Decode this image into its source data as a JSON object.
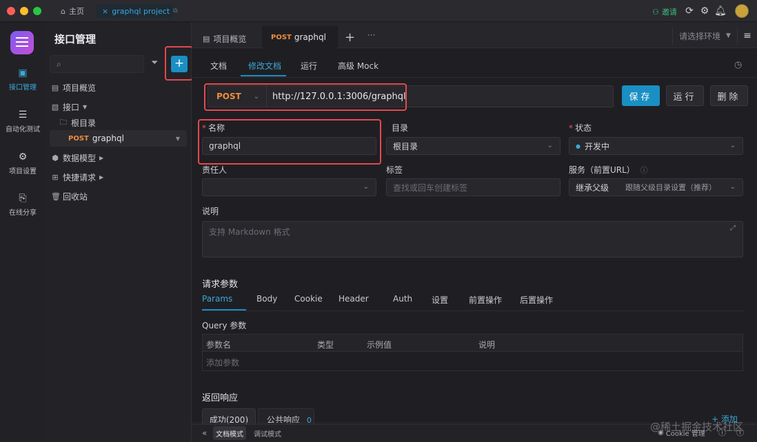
{
  "topbar": {
    "home_label": "主页",
    "project_tab_label": "graphql project",
    "invite_label": "邀请"
  },
  "rail": {
    "items": [
      {
        "label": "接口管理"
      },
      {
        "label": "自动化测试"
      },
      {
        "label": "项目设置"
      },
      {
        "label": "在线分享"
      }
    ]
  },
  "tree": {
    "title": "接口管理",
    "items": [
      {
        "label": "项目概览"
      },
      {
        "label": "接口"
      },
      {
        "label": "根目录"
      },
      {
        "method": "POST",
        "label": "graphql"
      },
      {
        "label": "数据模型"
      },
      {
        "label": "快捷请求"
      },
      {
        "label": "回收站"
      }
    ]
  },
  "tabs": {
    "overview": "项目概览",
    "active_method": "POST",
    "active_name": "graphql",
    "env_placeholder": "请选择环境"
  },
  "subtabs": [
    "文档",
    "修改文档",
    "运行",
    "高级 Mock"
  ],
  "request": {
    "method": "POST",
    "url": "http://127.0.0.1:3006/graphql",
    "save": "保存",
    "run": "运行",
    "delete": "删除"
  },
  "form": {
    "name_label": "名称",
    "name_value": "graphql",
    "dir_label": "目录",
    "dir_value": "根目录",
    "status_label": "状态",
    "status_value": "开发中",
    "owner_label": "责任人",
    "tags_label": "标签",
    "tags_placeholder": "查找或回车创建标签",
    "service_label": "服务（前置URL）",
    "service_inherit": "继承父级",
    "service_value": "跟随父级目录设置（推荐）",
    "desc_label": "说明",
    "desc_placeholder": "支持 Markdown 格式"
  },
  "params": {
    "title": "请求参数",
    "tabs": [
      "Params",
      "Body",
      "Cookie",
      "Header",
      "Auth",
      "设置",
      "前置操作",
      "后置操作"
    ],
    "query_title": "Query 参数",
    "columns": [
      "参数名",
      "类型",
      "示例值",
      "说明"
    ],
    "add_placeholder": "添加参数"
  },
  "response": {
    "title": "返回响应",
    "tabs": [
      {
        "label": "成功(200)"
      },
      {
        "label": "公共响应",
        "count": "0"
      }
    ],
    "add": "+ 添加"
  },
  "bottom": {
    "doc_mode": "文档模式",
    "debug_mode": "调试模式",
    "cookie_label": "Cookie 管理"
  },
  "watermark": "@稀土掘金技术社区",
  "colors": {
    "accent": "#1a8fc4",
    "method_post": "#f08c3c",
    "highlight": "#e5484d",
    "required": "#e85454"
  }
}
